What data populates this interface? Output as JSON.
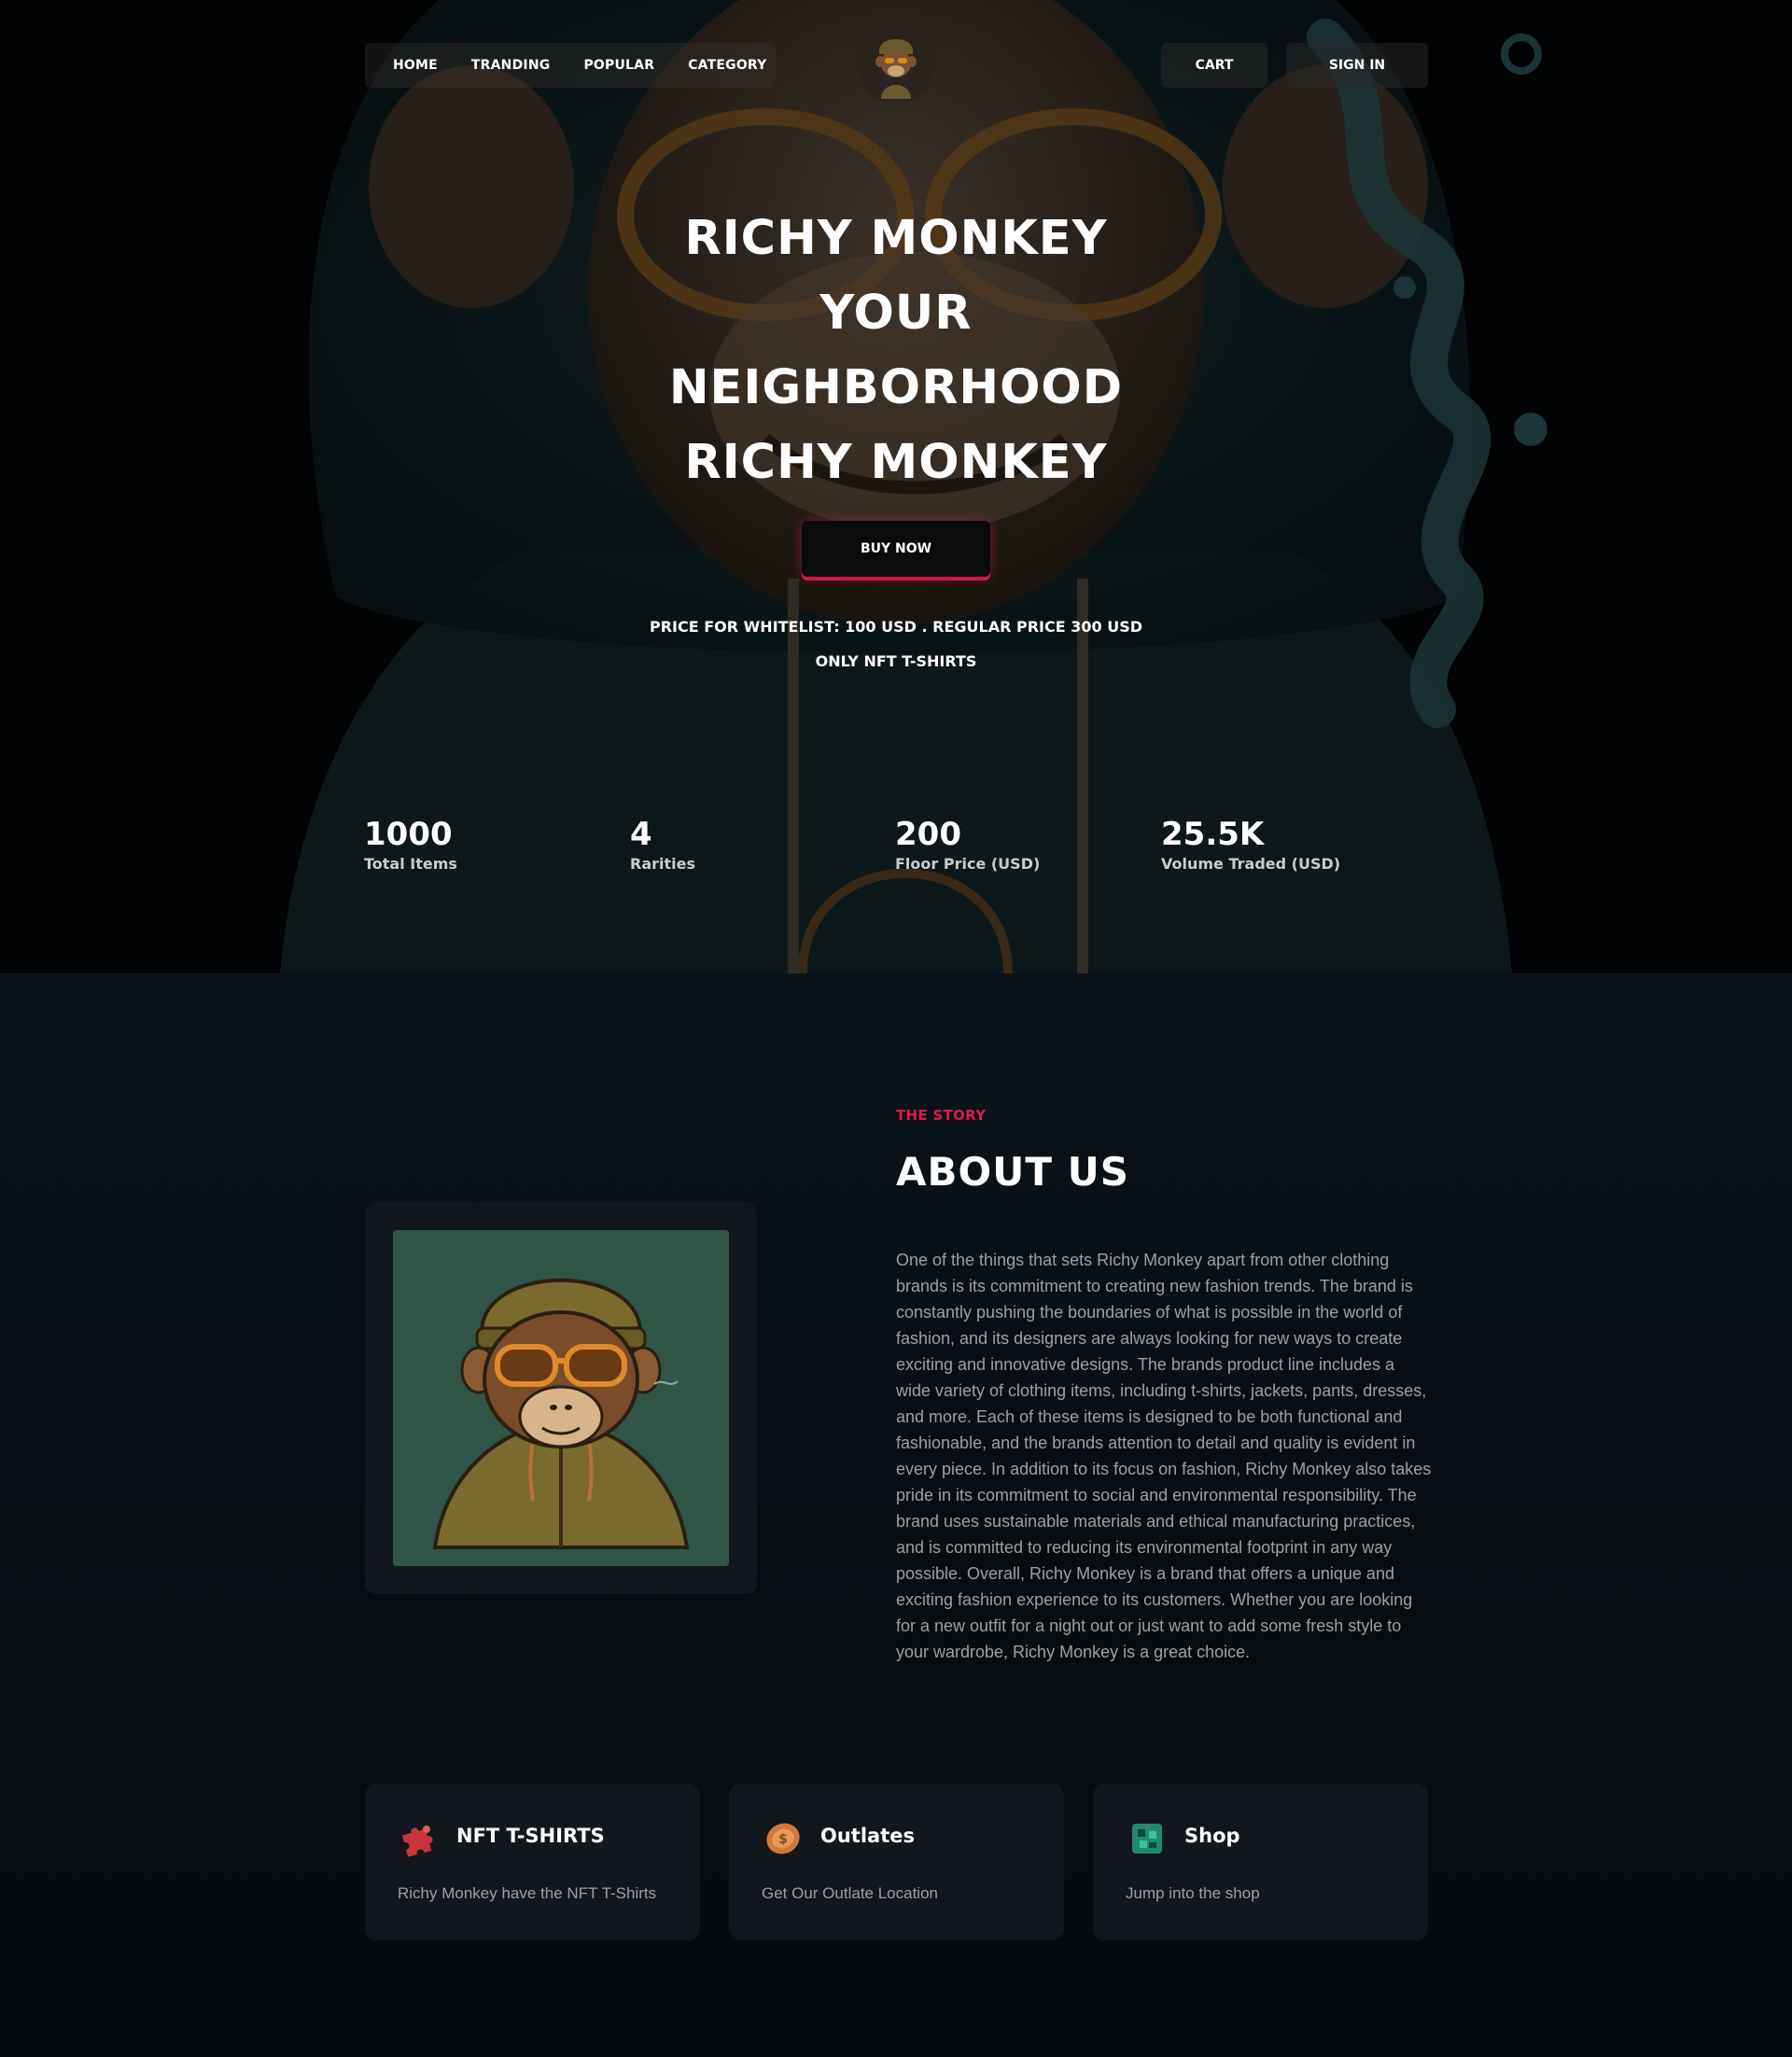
{
  "nav": {
    "links": [
      "HOME",
      "TRANDING",
      "POPULAR",
      "CATEGORY"
    ],
    "cart": "CART",
    "sign_in": "SIGN IN",
    "logo_icon": "monkey-logo-icon"
  },
  "hero": {
    "title_lines": [
      "RICHY MONKEY",
      "YOUR",
      "NEIGHBORHOOD",
      "RICHY MONKEY"
    ],
    "buy_button": "BUY NOW",
    "price_text": "PRICE FOR WHITELIST: 100 USD . REGULAR PRICE 300 USD",
    "only_text": "ONLY NFT T-SHIRTS",
    "accent_color": "#d2184a"
  },
  "stats": [
    {
      "value": "1000",
      "label": "Total Items"
    },
    {
      "value": "4",
      "label": "Rarities"
    },
    {
      "value": "200",
      "label": "Floor Price (USD)"
    },
    {
      "value": "25.5K",
      "label": "Volume Traded (USD)"
    }
  ],
  "about": {
    "kicker": "THE STORY",
    "title": "ABOUT US",
    "body": "One of the things that sets Richy Monkey apart from other clothing brands is its commitment to creating new fashion trends. The brand is constantly pushing the boundaries of what is possible in the world of fashion, and its designers are always looking for new ways to create exciting and innovative designs. The brands product line includes a wide variety of clothing items, including t-shirts, jackets, pants, dresses, and more. Each of these items is designed to be both functional and fashionable, and the brands attention to detail and quality is evident in every piece. In addition to its focus on fashion, Richy Monkey also takes pride in its commitment to social and environmental responsibility. The brand uses sustainable materials and ethical manufacturing practices, and is committed to reducing its environmental footprint in any way possible. Overall, Richy Monkey is a brand that offers a unique and exciting fashion experience to its customers. Whether you are looking for a new outfit for a night out or just want to add some fresh style to your wardrobe, Richy Monkey is a great choice.",
    "kicker_color": "#e01a4a"
  },
  "features": [
    {
      "title": "NFT T-SHIRTS",
      "desc": "Richy Monkey have the NFT T-Shirts",
      "icon": "puzzle-icon"
    },
    {
      "title": "Outlates",
      "desc": "Get Our Outlate Location",
      "icon": "coin-icon"
    },
    {
      "title": "Shop",
      "desc": "Jump into the shop",
      "icon": "shop-icon"
    }
  ]
}
